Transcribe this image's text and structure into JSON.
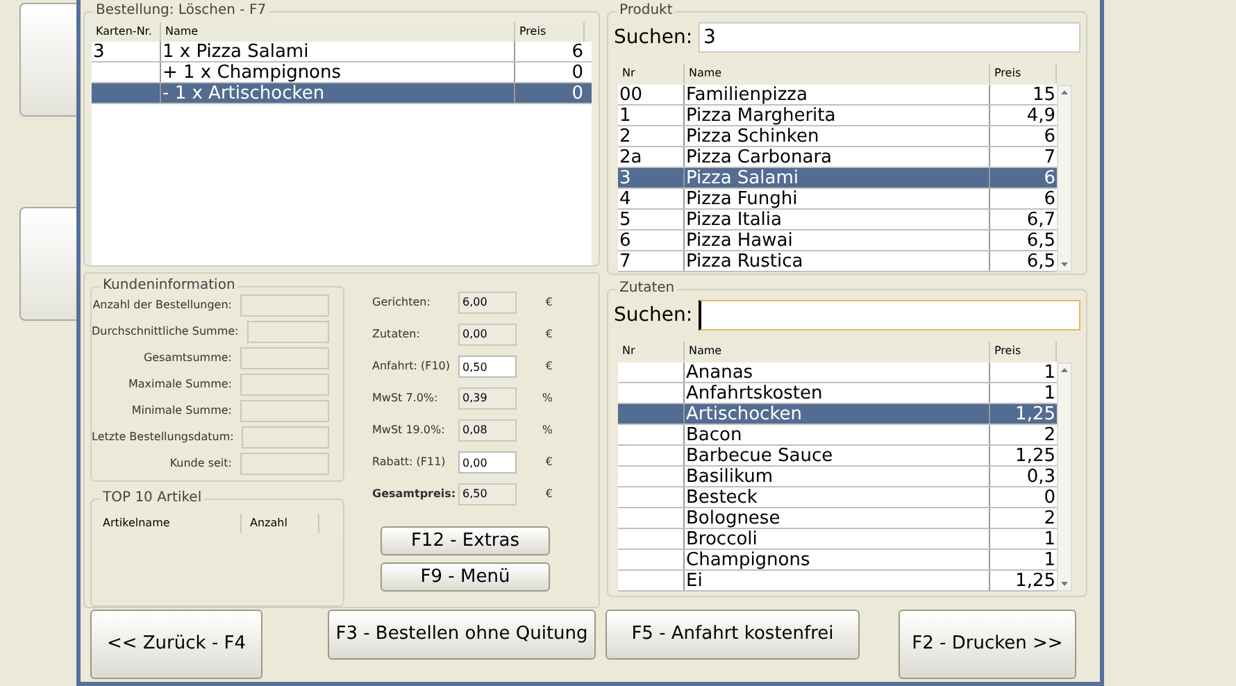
{
  "order": {
    "title": "Bestellung: Löschen - F7",
    "columns": [
      "Karten-Nr.",
      "Name",
      "Preis"
    ],
    "rows": [
      {
        "nr": "3",
        "name": "1 x Pizza Salami",
        "price": "6",
        "selected": false
      },
      {
        "nr": "",
        "name": "+ 1 x Champignons",
        "price": "0",
        "selected": false
      },
      {
        "nr": "",
        "name": "- 1 x Artischocken",
        "price": "0",
        "selected": true
      }
    ]
  },
  "customer": {
    "title": "Kundeninformation",
    "fields": [
      {
        "label": "Anzahl der Bestellungen:"
      },
      {
        "label": "Durchschnittliche Summe:"
      },
      {
        "label": "Gesamtsumme:"
      },
      {
        "label": "Maximale Summe:"
      },
      {
        "label": "Minimale Summe:"
      },
      {
        "label": "Letzte Bestellungsdatum:"
      },
      {
        "label": "Kunde seit:"
      }
    ]
  },
  "top10": {
    "title": "TOP 10 Artikel",
    "columns": [
      "Artikelname",
      "Anzahl"
    ]
  },
  "totals": [
    {
      "label": "Gerichten:",
      "value": "6,00",
      "unit": "€",
      "editable": false,
      "kind": "line"
    },
    {
      "label": "Zutaten:",
      "value": "0,00",
      "unit": "€",
      "editable": false,
      "kind": "line"
    },
    {
      "label": "Anfahrt: (F10)",
      "value": "0,50",
      "unit": "€",
      "editable": true,
      "kind": "line"
    },
    {
      "label": "MwSt 7.0%:",
      "value": "0,39",
      "unit": "%",
      "editable": false,
      "kind": "line"
    },
    {
      "label": "MwSt 19.0%:",
      "value": "0,08",
      "unit": "%",
      "editable": false,
      "kind": "line"
    },
    {
      "label": "Rabatt: (F11)",
      "value": "0,00",
      "unit": "€",
      "editable": true,
      "kind": "line"
    },
    {
      "label": "Gesamtpreis:",
      "value": "6,50",
      "unit": "€",
      "editable": false,
      "kind": "total"
    }
  ],
  "side_buttons": [
    "F12 - Extras",
    "F9 - Menü"
  ],
  "product": {
    "title": "Produkt",
    "search_label": "Suchen:",
    "search_value": "3",
    "focused": false,
    "columns": [
      "Nr",
      "Name",
      "Preis"
    ],
    "rows": [
      {
        "nr": "00",
        "name": "Familienpizza",
        "price": "15",
        "selected": false
      },
      {
        "nr": "1",
        "name": "Pizza Margherita",
        "price": "4,9",
        "selected": false
      },
      {
        "nr": "2",
        "name": "Pizza Schinken",
        "price": "6",
        "selected": false
      },
      {
        "nr": "2a",
        "name": "Pizza Carbonara",
        "price": "7",
        "selected": false
      },
      {
        "nr": "3",
        "name": "Pizza Salami",
        "price": "6",
        "selected": true
      },
      {
        "nr": "4",
        "name": "Pizza Funghi",
        "price": "6",
        "selected": false
      },
      {
        "nr": "5",
        "name": "Pizza Italia",
        "price": "6,7",
        "selected": false
      },
      {
        "nr": "6",
        "name": "Pizza Hawai",
        "price": "6,5",
        "selected": false
      },
      {
        "nr": "7",
        "name": "Pizza Rustica",
        "price": "6,5",
        "selected": false
      }
    ]
  },
  "ingredients": {
    "title": "Zutaten",
    "search_label": "Suchen:",
    "focused": true,
    "columns": [
      "Nr",
      "Name",
      "Preis"
    ],
    "rows": [
      {
        "nr": "",
        "name": "Ananas",
        "price": "1",
        "selected": false
      },
      {
        "nr": "",
        "name": "Anfahrtskosten",
        "price": "1",
        "selected": false
      },
      {
        "nr": "",
        "name": "Artischocken",
        "price": "1,25",
        "selected": true
      },
      {
        "nr": "",
        "name": "Bacon",
        "price": "2",
        "selected": false
      },
      {
        "nr": "",
        "name": "Barbecue Sauce",
        "price": "1,25",
        "selected": false
      },
      {
        "nr": "",
        "name": "Basilikum",
        "price": "0,3",
        "selected": false
      },
      {
        "nr": "",
        "name": "Besteck",
        "price": "0",
        "selected": false
      },
      {
        "nr": "",
        "name": "Bolognese",
        "price": "2",
        "selected": false
      },
      {
        "nr": "",
        "name": "Broccoli",
        "price": "1",
        "selected": false
      },
      {
        "nr": "",
        "name": "Champignons",
        "price": "1",
        "selected": false
      },
      {
        "nr": "",
        "name": "Ei",
        "price": "1,25",
        "selected": false
      }
    ]
  },
  "footer_buttons": [
    "<< Zurück - F4",
    "F3 - Bestellen ohne Quitung",
    "F5 - Anfahrt kostenfrei",
    "F2 - Drucken >>"
  ]
}
